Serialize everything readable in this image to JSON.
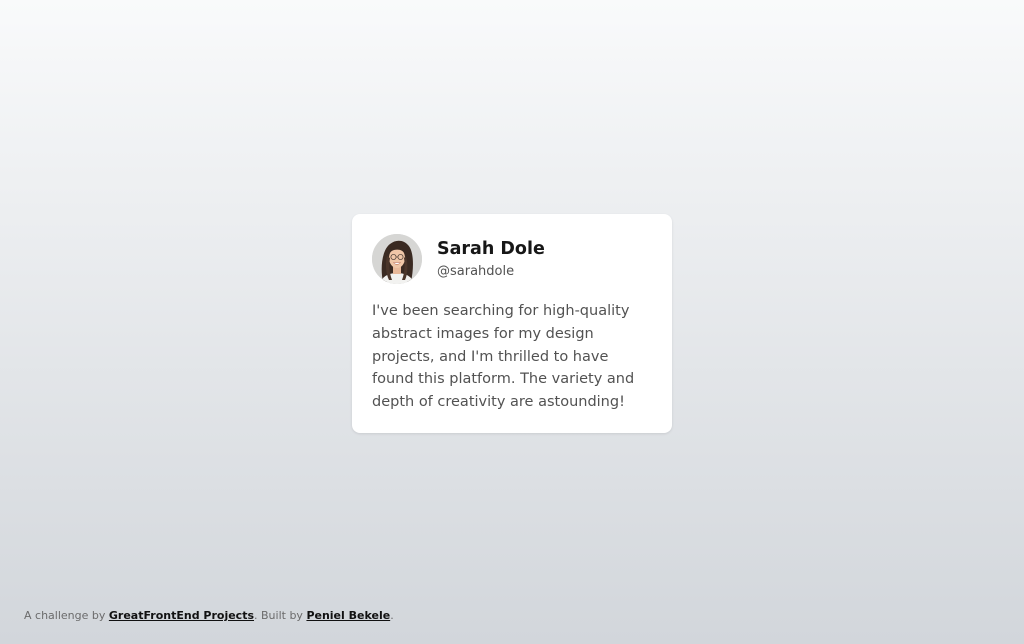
{
  "testimonial": {
    "name": "Sarah Dole",
    "handle": "@sarahdole",
    "text": "I've been searching for high-quality abstract images for my design projects, and I'm thrilled to have found this platform. The variety and depth of creativity are astounding!",
    "avatar_icon": "profile-photo"
  },
  "footer": {
    "prefix": "A challenge by ",
    "link1": "GreatFrontEnd Projects",
    "middle": ". Built by ",
    "link2": "Peniel Bekele",
    "suffix": "."
  },
  "colors": {
    "background_top": "#f9fafb",
    "background_bottom": "#d2d6db",
    "card": "#ffffff",
    "name_text": "#171717",
    "body_text": "#525252"
  }
}
